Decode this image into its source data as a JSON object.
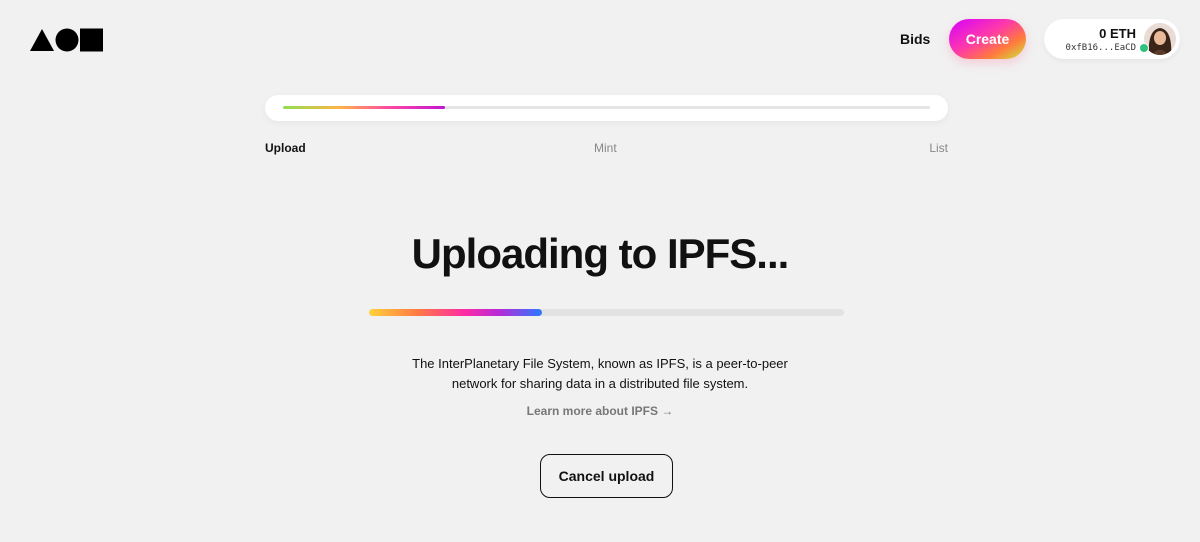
{
  "header": {
    "bids_label": "Bids",
    "create_label": "Create",
    "wallet": {
      "balance": "0 ETH",
      "address": "0xfB16...EaCD",
      "status_color": "#2ec27e"
    }
  },
  "stepper": {
    "steps": [
      {
        "label": "Upload",
        "active": true
      },
      {
        "label": "Mint",
        "active": false
      },
      {
        "label": "List",
        "active": false
      }
    ],
    "progress": 0.25
  },
  "main": {
    "heading": "Uploading to IPFS...",
    "upload_progress": 0.365,
    "description_line1": "The InterPlanetary File System, known as IPFS, is a peer-to-peer",
    "description_line2": "network for sharing data in a distributed file system.",
    "learn_more": "Learn more about IPFS →",
    "cancel_label": "Cancel upload"
  },
  "icons": {
    "logo": "triangle-circle-square-logo",
    "avatar": "user-avatar"
  },
  "colors": {
    "background": "#f1f1f1",
    "text": "#111111",
    "muted": "#888888"
  }
}
